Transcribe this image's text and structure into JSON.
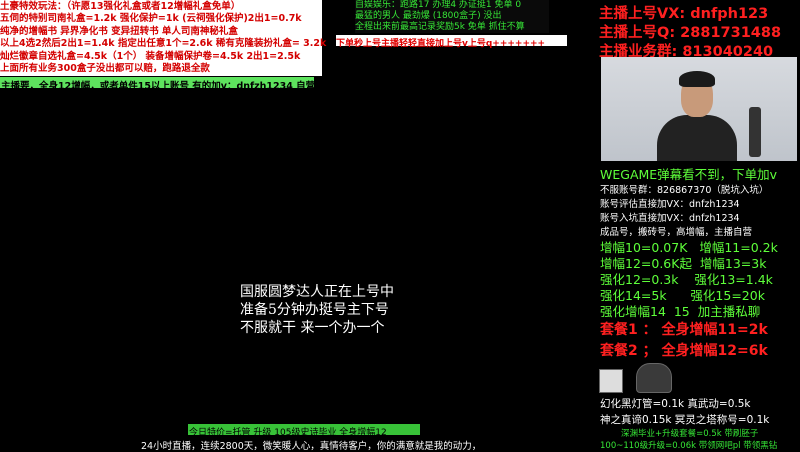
{
  "top_left": {
    "lines": [
      "土豪特效玩法：（许愿13强化礼盒或者12增幅礼盒免单）",
      "五伺的特别司南礼盒=1.2k  强化保护=1k  (云祠强化保护)2出1=0.7k",
      "纯净的增幅书  异界净化书  变异扭转书  单人司南神秘礼盒",
      "以上4选2然后2出1=1.4k  指定出任意1个=2.6k  稀有克隆装扮礼盒= 3.2k",
      "灿烂徽章自选礼盒=4.5k（1个）  装备增幅保护卷=4.5k  2出1=2.5k",
      "上面所有业务300盒子没出都可以赔，跑路退全款"
    ],
    "green_line": "主播要，全身12增幅，或者单件15以上账号 有的加v：dnfzh1234 自营"
  },
  "top_middle": {
    "lines": [
      "自娱娱乐：跑路17 办理4  办证挺1  免单 0",
      "最猛的男人  最劲爆  (1800盒子)  没出",
      "全程出来前最高记录奖励5k  免单  抓住不算"
    ],
    "red_line": "下单秒上号主播轻轻直接加上号v上号q+++++++"
  },
  "right": {
    "vx": "主播上号VX:  dnfph123",
    "qq": "主播上号Q:  2881731488",
    "group": "主播业务群:  813040240",
    "wegame": "WEGAME弹幕看不到，下单加v",
    "info": [
      "不服账号群：826867370（脱坑入坑）",
      "账号评估直接加VX：dnfzh1234",
      "账号入坑直接加VX：dnfzh1234",
      "成品号，搬砖号，高增幅，主播自营"
    ],
    "prices": [
      "增幅10=0.07K   增幅11=0.2k",
      "增幅12=0.6K起  增幅13=3k",
      "强化12=0.3k    强化13=1.4k",
      "强化14=5k      强化15=20k",
      "强化增幅14  15  加主播私聊"
    ],
    "package1": "套餐1 ： 全身增幅11=2k",
    "package2": "套餐2 ； 全身增幅12=6k",
    "bottom_lines": [
      "幻化黑灯管=0.1k 真武动=0.5k",
      "神之真谛0.15k  冥灵之塔称号=0.1k"
    ],
    "bottom_green": [
      "深渊毕业+升级套餐=0.5k  带刷胚子",
      "100~110级升级=0.06k  带领网吧pl  带领黑钻"
    ]
  },
  "center": {
    "lines": [
      "国服圆梦达人正在上号中",
      "准备5分钟办挺号主下号",
      "不服就干 来一个办一个"
    ]
  },
  "bottom": {
    "green_line": "今日特价=托管 升级 105级史诗毕业  全身增幅12",
    "white_line": "24小时直播，连续2800天，微笑暖人心，真情待客户，你的满意就是我的动力，"
  },
  "colors": {
    "red": "#ff2020",
    "green": "#5eff3a",
    "dark_green": "#36e636",
    "bg": "#000000"
  }
}
